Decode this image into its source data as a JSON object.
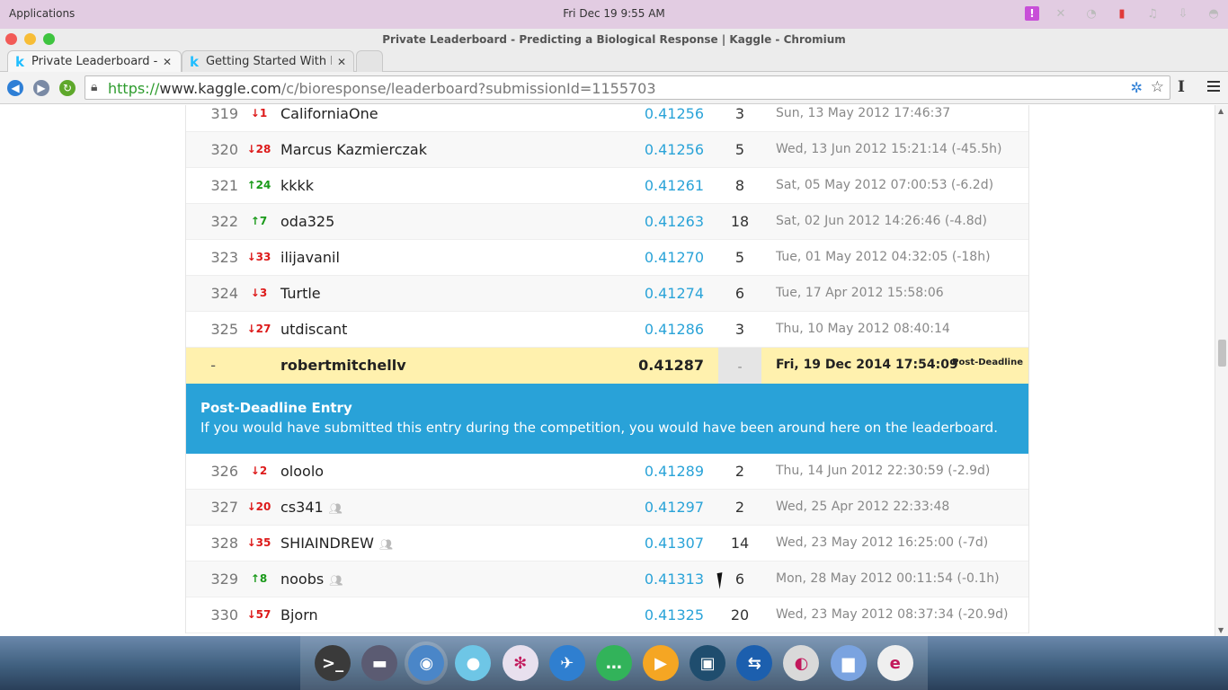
{
  "system": {
    "apps_label": "Applications",
    "clock": "Fri Dec 19  9:55 AM",
    "notification_glyph": "!"
  },
  "window": {
    "title": "Private Leaderboard - Predicting a Biological Response | Kaggle - Chromium"
  },
  "tabs": [
    {
      "label": "Private Leaderboard - P",
      "icon": "kaggle-k-icon"
    },
    {
      "label": "Getting Started With P",
      "icon": "kaggle-k-icon"
    }
  ],
  "address_bar": {
    "scheme": "https://",
    "host": "www.kaggle.com",
    "path": "/c/bioresponse/leaderboard?submissionId=1155703"
  },
  "leaderboard": {
    "rows_before": [
      {
        "rank": "319",
        "delta": "↓1",
        "dir": "down",
        "team": "CaliforniaOne",
        "score": "0.41256",
        "entries": "3",
        "last": "Sun, 13 May 2012 17:46:37",
        "team_icon": false
      },
      {
        "rank": "320",
        "delta": "↓28",
        "dir": "down",
        "team": "Marcus Kazmierczak",
        "score": "0.41256",
        "entries": "5",
        "last": "Wed, 13 Jun 2012 15:21:14 (-45.5h)",
        "team_icon": false
      },
      {
        "rank": "321",
        "delta": "↑24",
        "dir": "up",
        "team": "kkkk",
        "score": "0.41261",
        "entries": "8",
        "last": "Sat, 05 May 2012 07:00:53 (-6.2d)",
        "team_icon": false
      },
      {
        "rank": "322",
        "delta": "↑7",
        "dir": "up",
        "team": "oda325",
        "score": "0.41263",
        "entries": "18",
        "last": "Sat, 02 Jun 2012 14:26:46 (-4.8d)",
        "team_icon": false
      },
      {
        "rank": "323",
        "delta": "↓33",
        "dir": "down",
        "team": "ilijavanil",
        "score": "0.41270",
        "entries": "5",
        "last": "Tue, 01 May 2012 04:32:05 (-18h)",
        "team_icon": false
      },
      {
        "rank": "324",
        "delta": "↓3",
        "dir": "down",
        "team": "Turtle",
        "score": "0.41274",
        "entries": "6",
        "last": "Tue, 17 Apr 2012 15:58:06",
        "team_icon": false
      },
      {
        "rank": "325",
        "delta": "↓27",
        "dir": "down",
        "team": "utdiscant",
        "score": "0.41286",
        "entries": "3",
        "last": "Thu, 10 May 2012 08:40:14",
        "team_icon": false
      }
    ],
    "your_entry": {
      "rank": "-",
      "team": "robertmitchellv",
      "score": "0.41287",
      "entries": "-",
      "last": "Fri, 19 Dec 2014 17:54:09",
      "badge": "Post-Deadline"
    },
    "banner": {
      "title": "Post-Deadline Entry",
      "text": "If you would have submitted this entry during the competition, you would have been around here on the leaderboard."
    },
    "rows_after": [
      {
        "rank": "326",
        "delta": "↓2",
        "dir": "down",
        "team": "oloolo",
        "score": "0.41289",
        "entries": "2",
        "last": "Thu, 14 Jun 2012 22:30:59 (-2.9d)",
        "team_icon": false
      },
      {
        "rank": "327",
        "delta": "↓20",
        "dir": "down",
        "team": "cs341",
        "score": "0.41297",
        "entries": "2",
        "last": "Wed, 25 Apr 2012 22:33:48",
        "team_icon": true
      },
      {
        "rank": "328",
        "delta": "↓35",
        "dir": "down",
        "team": "SHIAINDREW",
        "score": "0.41307",
        "entries": "14",
        "last": "Wed, 23 May 2012 16:25:00 (-7d)",
        "team_icon": true
      },
      {
        "rank": "329",
        "delta": "↑8",
        "dir": "up",
        "team": "noobs",
        "score": "0.41313",
        "entries": "6",
        "last": "Mon, 28 May 2012 00:11:54 (-0.1h)",
        "team_icon": true
      },
      {
        "rank": "330",
        "delta": "↓57",
        "dir": "down",
        "team": "Bjorn",
        "score": "0.41325",
        "entries": "20",
        "last": "Wed, 23 May 2012 08:37:34 (-20.9d)",
        "team_icon": false
      }
    ]
  },
  "dock": {
    "apps": [
      {
        "name": "terminal-app-icon",
        "glyph": ">_",
        "color": "#3a3a3a"
      },
      {
        "name": "files-app-icon",
        "glyph": "▬",
        "color": "#5b5b72"
      },
      {
        "name": "chromium-app-icon",
        "glyph": "◉",
        "color": "#4a86c8",
        "active": true
      },
      {
        "name": "bird-app-icon",
        "glyph": "●",
        "color": "#6ec6e6"
      },
      {
        "name": "atom-app-icon",
        "glyph": "✻",
        "color": "#e8e0ee"
      },
      {
        "name": "mail-app-icon",
        "glyph": "✈",
        "color": "#2f7fd0"
      },
      {
        "name": "chat-app-icon",
        "glyph": "…",
        "color": "#32b35a"
      },
      {
        "name": "media-app-icon",
        "glyph": "▶",
        "color": "#f5a623"
      },
      {
        "name": "screenshot-app-icon",
        "glyph": "▣",
        "color": "#1f4d6e"
      },
      {
        "name": "connect-app-icon",
        "glyph": "⇆",
        "color": "#1c5fae"
      },
      {
        "name": "toggles-app-icon",
        "glyph": "◐",
        "color": "#d9d9d9"
      },
      {
        "name": "folder-app-icon",
        "glyph": "▆",
        "color": "#7aa3e0"
      },
      {
        "name": "writer-app-icon",
        "glyph": "e",
        "color": "#efefef"
      }
    ]
  }
}
